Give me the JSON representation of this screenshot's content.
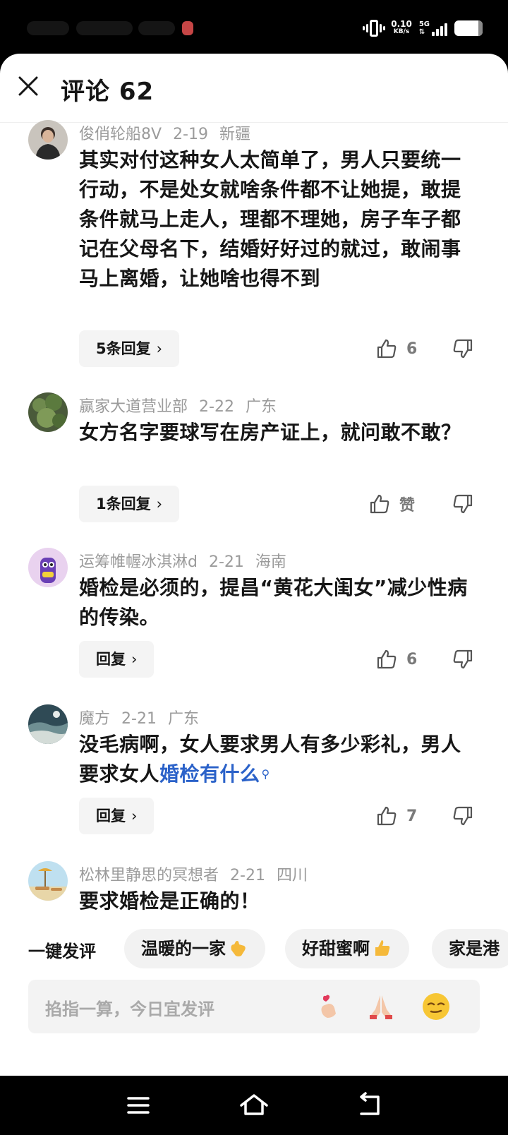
{
  "header": {
    "title": "评论 62"
  },
  "status": {
    "speed_value": "0.10",
    "speed_unit": "KB/s",
    "network": "5G"
  },
  "comments": [
    {
      "user": "俊俏轮船8V",
      "date": "2-19",
      "location": "新疆",
      "text": "其实对付这种女人太简单了，男人只要统一行动，不是处女就啥条件都不让她提，敢提条件就马上走人，理都不理她，房子车子都记在父母名下，结婚好好过的就过，敢闹事马上离婚，让她啥也得不到",
      "reply_label": "5条回复",
      "likes": "6"
    },
    {
      "user": "赢家大道营业部",
      "date": "2-22",
      "location": "广东",
      "text": "女方名字要球写在房产证上，就问敢不敢？",
      "reply_label": "1条回复",
      "likes": "赞"
    },
    {
      "user": "运筹帷幄冰淇淋d",
      "date": "2-21",
      "location": "海南",
      "text": "婚检是必须的，提昌“黄花大闺女”减少性病的传染。",
      "reply_label": "回复",
      "likes": "6"
    },
    {
      "user": "魔方",
      "date": "2-21",
      "location": "广东",
      "text_plain": "没毛病啊，女人要求男人有多少彩礼，男人要求女人",
      "text_link": "婚检有什么",
      "reply_label": "回复",
      "likes": "7"
    },
    {
      "user": "松林里静思的冥想者",
      "date": "2-21",
      "location": "四川",
      "text": "要求婚检是正确的！"
    }
  ],
  "quick": {
    "label": "一键发评",
    "chips": [
      "温暖的一家",
      "好甜蜜啊",
      "家是港"
    ]
  },
  "input": {
    "placeholder": "掐指一算，今日宜发评"
  },
  "colors": {
    "link": "#2b62c9",
    "meta": "#9b9b9b",
    "text": "#161616"
  }
}
